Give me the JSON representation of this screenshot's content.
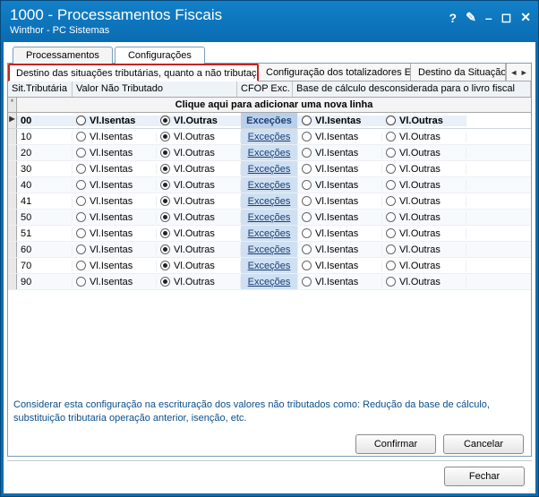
{
  "window": {
    "title": "1000 - Processamentos Fiscais",
    "subtitle": "Winthor - PC Sistemas"
  },
  "outer_tabs": {
    "t0": "Processamentos",
    "t1": "Configurações"
  },
  "inner_tabs": {
    "t0": "Destino das situações tributárias, quanto a não tributação",
    "t1": "Configuração dos totalizadores ECF",
    "t2": "Destino da Situação Trib"
  },
  "col_headers": {
    "sit": "Sit.Tributária",
    "vnt": "Valor Não Tributado",
    "cfop": "CFOP Exc.",
    "base": "Base de cálculo desconsiderada para o livro fiscal"
  },
  "add_row_msg": "Clique aqui para adicionar uma nova linha",
  "table_header": {
    "code": "00",
    "r1": "Vl.Isentas",
    "r2": "Vl.Outras",
    "exc": "Exceções",
    "r3": "Vl.Isentas",
    "r4": "Vl.Outras"
  },
  "radio_labels": {
    "isentas": "Vl.Isentas",
    "outras": "Vl.Outras"
  },
  "exc_label": "Exceções",
  "rows": [
    {
      "code": "10"
    },
    {
      "code": "20"
    },
    {
      "code": "30"
    },
    {
      "code": "40"
    },
    {
      "code": "41"
    },
    {
      "code": "50"
    },
    {
      "code": "51"
    },
    {
      "code": "60"
    },
    {
      "code": "70"
    },
    {
      "code": "90"
    }
  ],
  "footer_note": "Considerar esta configuração na escrituração dos valores não tributados como: Redução da base de cálculo, substituição tributaria operação anterior, isenção, etc.",
  "buttons": {
    "confirm": "Confirmar",
    "cancel": "Cancelar",
    "close": "Fechar"
  }
}
